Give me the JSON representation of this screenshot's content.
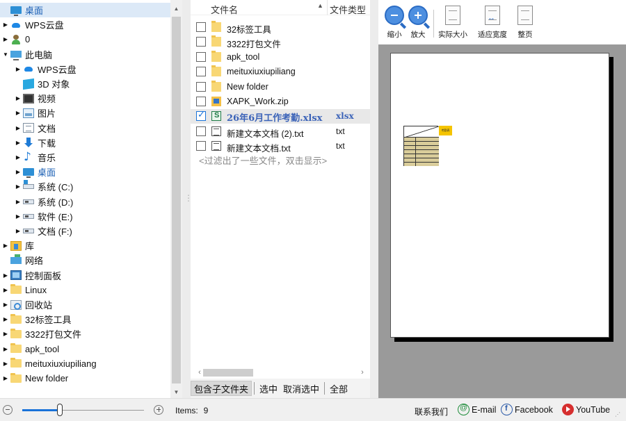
{
  "tree": {
    "items": [
      {
        "label": "桌面",
        "icon": "desktop-icon",
        "arrow": "",
        "selected": true
      },
      {
        "label": "WPS云盘",
        "icon": "cloud-icon",
        "arrow": "▶"
      },
      {
        "label": "0",
        "icon": "user-icon",
        "arrow": "▶"
      },
      {
        "label": "此电脑",
        "icon": "computer-icon",
        "arrow": "▼"
      },
      {
        "label": "WPS云盘",
        "icon": "cloud-icon",
        "arrow": "▶"
      },
      {
        "label": "3D 对象",
        "icon": "cube-icon",
        "arrow": ""
      },
      {
        "label": "视频",
        "icon": "video-icon",
        "arrow": "▶"
      },
      {
        "label": "图片",
        "icon": "picture-icon",
        "arrow": "▶"
      },
      {
        "label": "文档",
        "icon": "document-icon",
        "arrow": "▶"
      },
      {
        "label": "下载",
        "icon": "download-icon",
        "arrow": "▶"
      },
      {
        "label": "音乐",
        "icon": "music-icon",
        "arrow": "▶"
      },
      {
        "label": "桌面",
        "icon": "desktop-icon",
        "arrow": "▶",
        "bold": true
      },
      {
        "label": "系统 (C:)",
        "icon": "system-drive-icon",
        "arrow": "▶"
      },
      {
        "label": "系统 (D:)",
        "icon": "drive-icon",
        "arrow": "▶"
      },
      {
        "label": "软件 (E:)",
        "icon": "drive-icon",
        "arrow": "▶"
      },
      {
        "label": "文档 (F:)",
        "icon": "drive-icon",
        "arrow": "▶"
      },
      {
        "label": "库",
        "icon": "library-icon",
        "arrow": "▶"
      },
      {
        "label": "网络",
        "icon": "network-icon",
        "arrow": ""
      },
      {
        "label": "控制面板",
        "icon": "control-panel-icon",
        "arrow": "▶"
      },
      {
        "label": "Linux",
        "icon": "folder-icon",
        "arrow": "▶"
      },
      {
        "label": "回收站",
        "icon": "recycle-bin-icon",
        "arrow": "▶"
      },
      {
        "label": "32标签工具",
        "icon": "folder-icon",
        "arrow": "▶"
      },
      {
        "label": "3322打包文件",
        "icon": "folder-icon",
        "arrow": "▶"
      },
      {
        "label": "apk_tool",
        "icon": "folder-icon",
        "arrow": "▶"
      },
      {
        "label": "meituxiuxiupiliang",
        "icon": "folder-icon",
        "arrow": "▶"
      },
      {
        "label": "New folder",
        "icon": "folder-icon",
        "arrow": "▶"
      }
    ]
  },
  "filelist": {
    "header_name": "文件名",
    "header_type": "文件类型",
    "sort_glyph": "▲",
    "files": [
      {
        "name": "32标签工具",
        "type": "",
        "icon": "folder-icon",
        "checked": false
      },
      {
        "name": "3322打包文件",
        "type": "",
        "icon": "folder-icon",
        "checked": false
      },
      {
        "name": "apk_tool",
        "type": "",
        "icon": "folder-icon",
        "checked": false
      },
      {
        "name": "meituxiuxiupiliang",
        "type": "",
        "icon": "folder-icon",
        "checked": false
      },
      {
        "name": "New folder",
        "type": "",
        "icon": "folder-icon",
        "checked": false
      },
      {
        "name": "XAPK_Work.zip",
        "type": "",
        "icon": "zip-icon",
        "checked": false
      },
      {
        "name": "26年6月工作考勤.xlsx",
        "type": "xlsx",
        "icon": "xlsx-icon",
        "checked": true
      },
      {
        "name": "新建文本文档 (2).txt",
        "type": "txt",
        "icon": "txt-icon",
        "checked": false
      },
      {
        "name": "新建文本文档.txt",
        "type": "txt",
        "icon": "txt-icon",
        "checked": false
      }
    ],
    "filtered_note": "<过滤出了一些文件，双击显示>",
    "bar": {
      "include_subfolders": "包含子文件夹",
      "select": "选中",
      "deselect": "取消选中",
      "all": "全部"
    }
  },
  "preview": {
    "toolbar": {
      "zoom_out": "缩小",
      "zoom_in": "放大",
      "actual_size": "实际大小",
      "fit_width": "适应宽度",
      "whole_page": "整页"
    },
    "mini_tag": "考勤表"
  },
  "status": {
    "items_label": "Items:",
    "items_count": "9",
    "zoom_level": 0.31,
    "contact": "联系我们",
    "email": "E-mail",
    "facebook": "Facebook",
    "youtube": "YouTube"
  },
  "colors": {
    "selection": "#dce9f7",
    "accent": "#1a73d9",
    "selected_file_text": "#3b63b8",
    "preview_bg": "#9a9a9a"
  }
}
